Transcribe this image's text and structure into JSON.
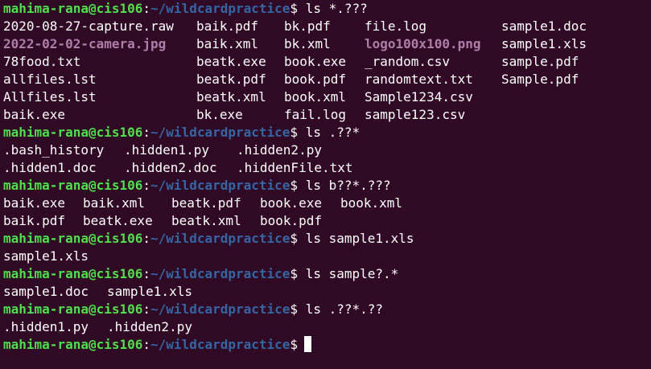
{
  "prompt": {
    "user_host": "mahima-rana@cis106",
    "colon": ":",
    "path": "~/wildcardpractice",
    "dollar": "$"
  },
  "colors": {
    "background": "#300a24",
    "user_host": "#4ee04b",
    "path": "#3465a4",
    "image_file": "#ad7fa8",
    "text": "#ffffff"
  },
  "commands": [
    {
      "command": "ls *.???"
    },
    {
      "command": "ls .??*"
    },
    {
      "command": "ls b??*.???"
    },
    {
      "command": "ls sample1.xls"
    },
    {
      "command": "ls sample?.*"
    },
    {
      "command": "ls .??*.??"
    }
  ],
  "outputs": [
    [
      [
        "2020-08-27-capture.raw",
        "baik.pdf",
        "bk.pdf",
        "file.log",
        "sample1.doc"
      ],
      [
        "2022-02-02-camera.jpg",
        "baik.xml",
        "bk.xml",
        "logo100x100.png",
        "sample1.xls"
      ],
      [
        "78food.txt",
        "beatk.exe",
        "book.exe",
        "_random.csv",
        "sample.pdf"
      ],
      [
        "allfiles.lst",
        "beatk.pdf",
        "book.pdf",
        "randomtext.txt",
        "Sample.pdf"
      ],
      [
        "Allfiles.lst",
        "beatk.xml",
        "book.xml",
        "Sample1234.csv",
        ""
      ],
      [
        "baik.exe",
        "bk.exe",
        "fail.log",
        "sample123.csv",
        ""
      ]
    ],
    [
      [
        ".bash_history",
        ".hidden1.py",
        ".hidden2.py"
      ],
      [
        ".hidden1.doc",
        ".hidden2.doc",
        ".hiddenFile.txt"
      ]
    ],
    [
      [
        "baik.exe",
        "baik.xml",
        "beatk.pdf",
        "book.exe",
        "book.xml"
      ],
      [
        "baik.pdf",
        "beatk.exe",
        "beatk.xml",
        "book.pdf",
        ""
      ]
    ],
    [
      [
        "sample1.xls"
      ]
    ],
    [
      [
        "sample1.doc",
        "sample1.xls"
      ]
    ],
    [
      [
        ".hidden1.py",
        ".hidden2.py"
      ]
    ]
  ],
  "image_files": [
    "2022-02-02-camera.jpg",
    "logo100x100.png"
  ]
}
